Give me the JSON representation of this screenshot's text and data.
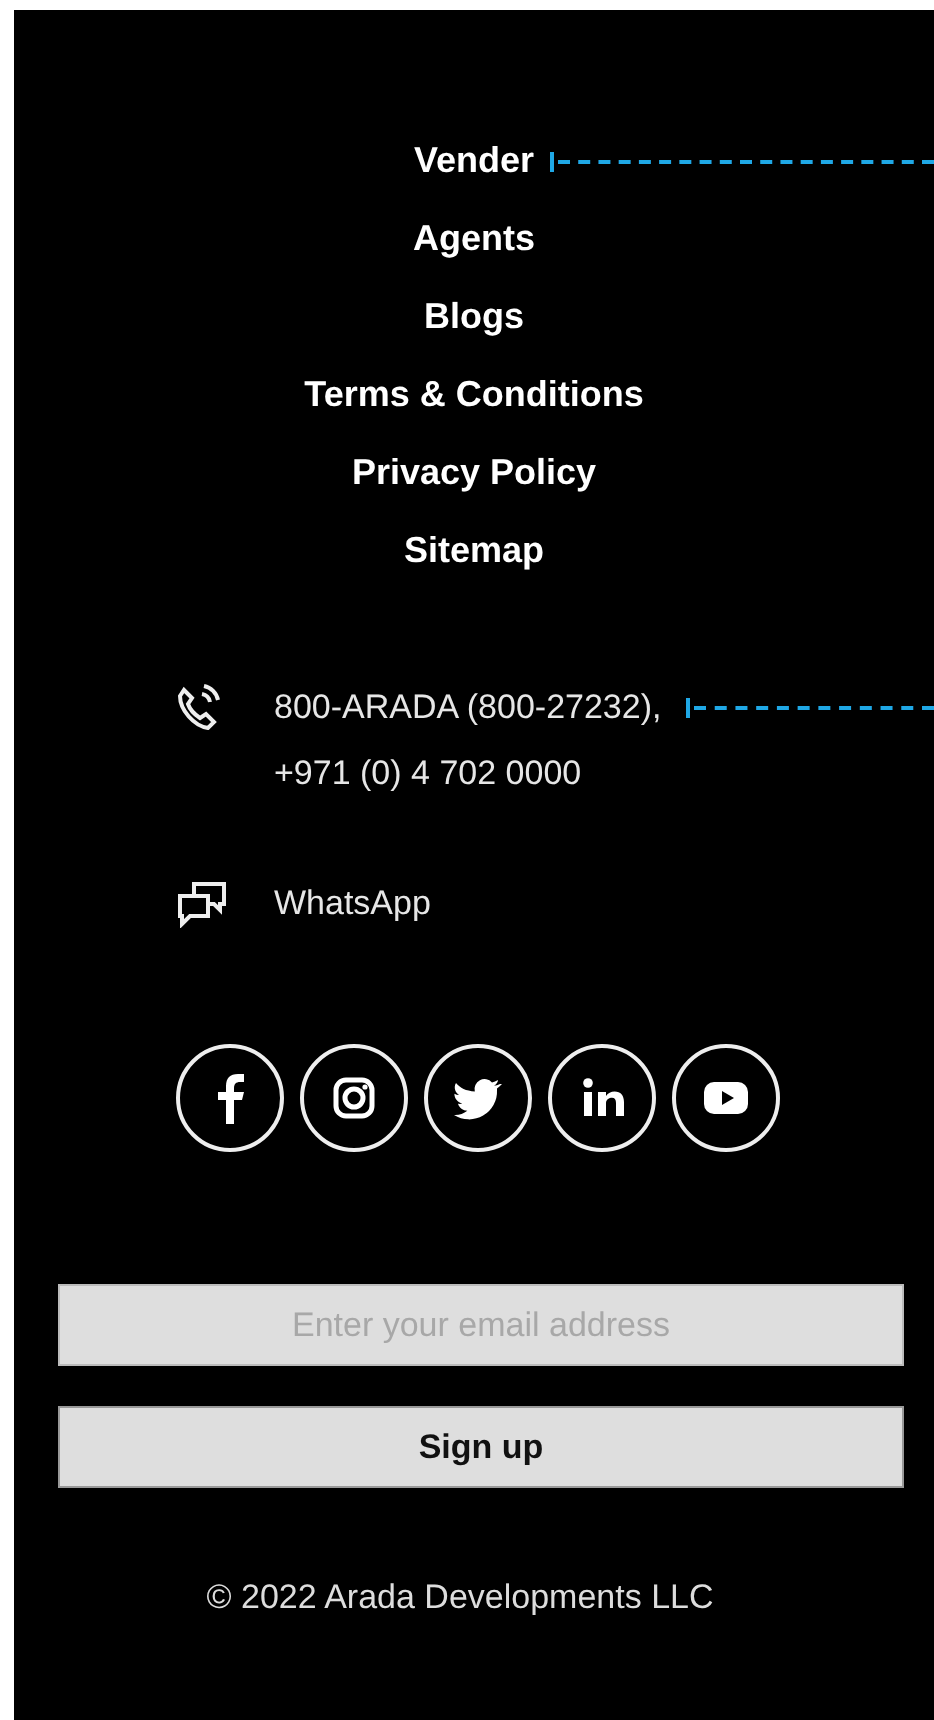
{
  "nav_links": [
    {
      "label": "Vender",
      "leader": true
    },
    {
      "label": "Agents",
      "leader": false
    },
    {
      "label": "Blogs",
      "leader": false
    },
    {
      "label": "Terms & Conditions",
      "leader": false
    },
    {
      "label": "Privacy Policy",
      "leader": false
    },
    {
      "label": "Sitemap",
      "leader": false
    }
  ],
  "contacts": [
    {
      "kind": "phone",
      "lines": [
        "800-ARADA (800-27232),",
        "+971 (0) 4 702 0000"
      ],
      "leader": true
    },
    {
      "kind": "chat",
      "lines": [
        "WhatsApp"
      ],
      "leader": false
    }
  ],
  "social": [
    {
      "kind": "facebook"
    },
    {
      "kind": "instagram"
    },
    {
      "kind": "twitter"
    },
    {
      "kind": "linkedin"
    },
    {
      "kind": "youtube"
    }
  ],
  "newsletter": {
    "placeholder": "Enter your email address",
    "button": "Sign up"
  },
  "copyright": "© 2022 Arada Developments LLC"
}
